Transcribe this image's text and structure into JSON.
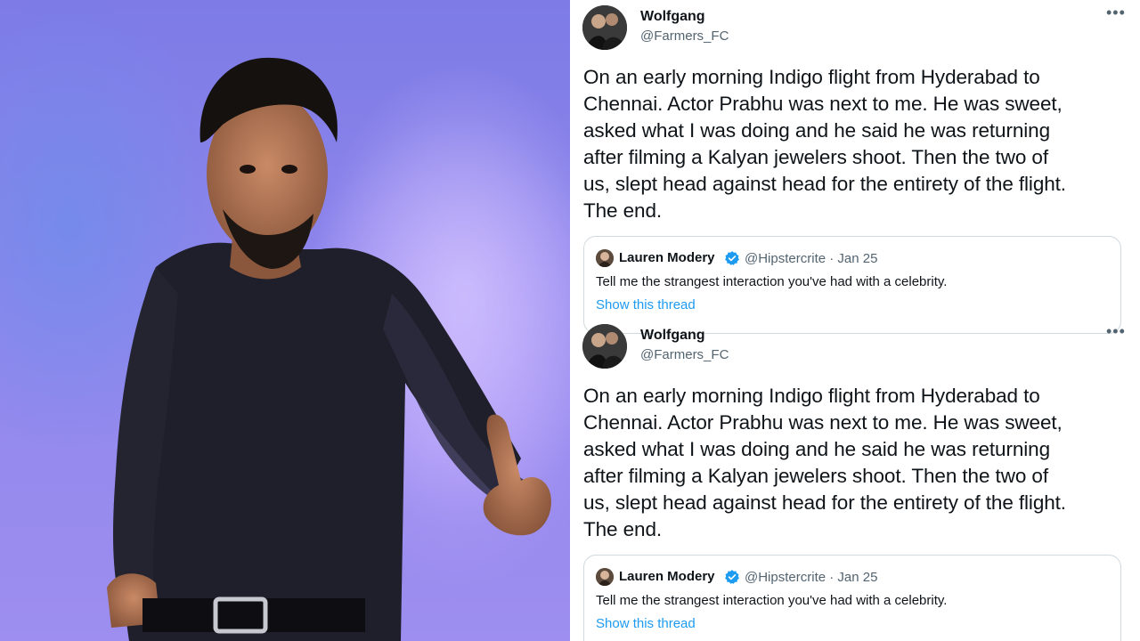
{
  "photo": {
    "subject": "performer-photo",
    "background_color": "#8a84ea"
  },
  "tweets": [
    {
      "author_name": "Wolfgang",
      "author_handle": "@Farmers_FC",
      "more_icon": "•••",
      "text": "On an early morning Indigo flight from Hyderabad to\nChennai.  Actor Prabhu was next to me. He was sweet,\nasked what I was doing and he said he was returning\nafter filming a Kalyan jewelers shoot. Then the two of\nus, slept head against head for the entirety of the flight.\nThe end.",
      "quoted": {
        "author_name": "Lauren Modery",
        "author_handle": "@Hipstercrite",
        "date": "Jan 25",
        "handle_date": "@Hipstercrite · Jan 25",
        "text": "Tell me the strangest interaction you've had with a celebrity.",
        "link_label": "Show this thread"
      }
    },
    {
      "author_name": "Wolfgang",
      "author_handle": "@Farmers_FC",
      "more_icon": "•••",
      "text": "On an early morning Indigo flight from Hyderabad to\nChennai.  Actor Prabhu was next to me. He was sweet,\nasked what I was doing and he said he was returning\nafter filming a Kalyan jewelers shoot. Then the two of\nus, slept head against head for the entirety of the flight.\nThe end.",
      "quoted": {
        "author_name": "Lauren Modery",
        "author_handle": "@Hipstercrite",
        "date": "Jan 25",
        "handle_date": "@Hipstercrite · Jan 25",
        "text": "Tell me the strangest interaction you've had with a celebrity.",
        "link_label": "Show this thread"
      }
    }
  ],
  "colors": {
    "text_primary": "#0f1419",
    "text_secondary": "#536471",
    "link": "#1d9bf0",
    "verified": "#1d9bf0",
    "border": "#cfd9de"
  }
}
